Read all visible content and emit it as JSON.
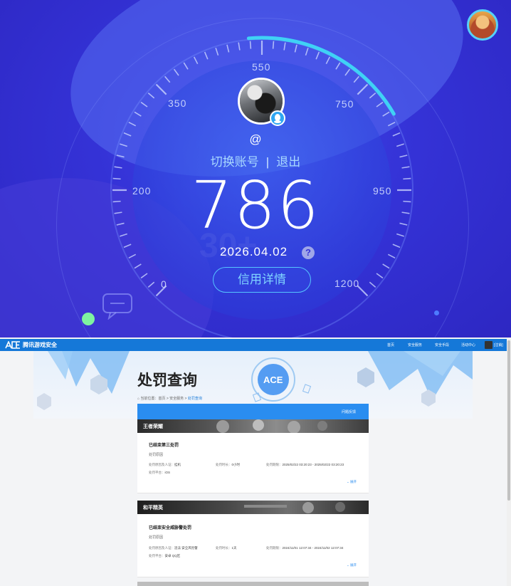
{
  "gauge": {
    "ticks": [
      "0",
      "200",
      "350",
      "550",
      "750",
      "950",
      "1200"
    ]
  },
  "account": {
    "at_sign": "@",
    "switch_account": "切换账号",
    "separator": "|",
    "logout": "退出"
  },
  "credit": {
    "score": "786",
    "date": "2026.04.02",
    "help": "?",
    "detail_button": "信用详情"
  },
  "site": {
    "name": "腾讯游戏安全",
    "nav": [
      "首页",
      "安全服务",
      "安全手段",
      "活动中心"
    ],
    "user": "[注销]"
  },
  "page": {
    "title": "处罚查询",
    "breadcrumb": [
      "当前位置：",
      "首页",
      " > ",
      "安全服务",
      " > ",
      "处罚查询"
    ],
    "panel_tab": "问题反馈"
  },
  "penalties": [
    {
      "game": "王者荣耀",
      "title": "已结束第三处罚",
      "subtitle": "处罚原因",
      "info": [
        {
          "label": "处罚原因及人证：",
          "value": "挂机"
        },
        {
          "label": "处罚时长：",
          "value": "0小时"
        },
        {
          "label": "处罚期限：",
          "value": "2025/02/22 03:20:23 - 2025/02/22 03:20:23"
        }
      ],
      "platform_label": "处罚平台：",
      "platform_value": "iOS",
      "expand": "展开"
    },
    {
      "game": "和平精英",
      "title": "已结束安全威胁警处罚",
      "subtitle": "处罚原因",
      "info": [
        {
          "label": "处罚原因及人证：",
          "value": "违法 安全风险警"
        },
        {
          "label": "处罚时长：",
          "value": "1天"
        },
        {
          "label": "处罚期限：",
          "value": "2024/11/01 12:07:34 - 2024/11/02 12:07:34"
        }
      ],
      "platform_label": "处罚平台：",
      "platform_value": "安卓 QQ区",
      "expand": "展开"
    }
  ],
  "colors": {
    "panel_bg": "#3432d6",
    "accent_cyan": "#56c4ff",
    "site_blue": "#1578d8"
  }
}
